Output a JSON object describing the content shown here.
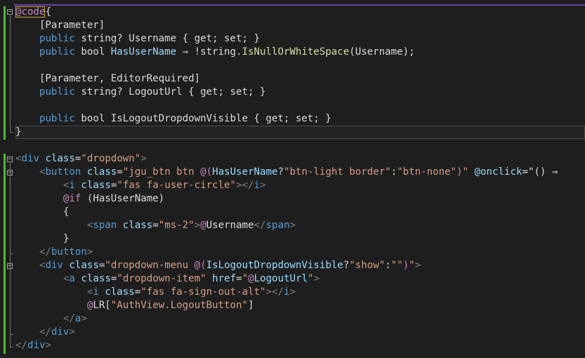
{
  "editor": {
    "language": "razor",
    "lines": [
      [
        [
          "@code",
          "razor"
        ],
        [
          "{",
          "plain"
        ]
      ],
      [
        [
          "    [Parameter]",
          "plain"
        ]
      ],
      [
        [
          "    ",
          "plain"
        ],
        [
          "public",
          "blue"
        ],
        [
          " string? ",
          "plain"
        ],
        [
          "Username",
          "plain"
        ],
        [
          " { get; set; }",
          "plain"
        ]
      ],
      [
        [
          "    ",
          "plain"
        ],
        [
          "public",
          "blue"
        ],
        [
          " bool ",
          "plain"
        ],
        [
          "HasUserName",
          "attr"
        ],
        [
          " ⇒ !string.",
          "plain"
        ],
        [
          "IsNullOrWhiteSpace",
          "method"
        ],
        [
          "(Username);",
          "plain"
        ]
      ],
      [
        [
          "",
          "plain"
        ]
      ],
      [
        [
          "    [Parameter, EditorRequired]",
          "plain"
        ]
      ],
      [
        [
          "    ",
          "plain"
        ],
        [
          "public",
          "blue"
        ],
        [
          " string? LogoutUrl { get; set; }",
          "plain"
        ]
      ],
      [
        [
          "",
          "plain"
        ]
      ],
      [
        [
          "    ",
          "plain"
        ],
        [
          "public",
          "blue"
        ],
        [
          " bool IsLogoutDropdownVisible { get; set; }",
          "plain"
        ]
      ],
      [
        [
          "}",
          "plain"
        ]
      ],
      [
        [
          "",
          "plain"
        ]
      ],
      [
        [
          "<",
          "brk"
        ],
        [
          "div",
          "tag"
        ],
        [
          " ",
          "plain"
        ],
        [
          "class",
          "attr"
        ],
        [
          "=",
          "plain"
        ],
        [
          "\"dropdown\"",
          "str"
        ],
        [
          ">",
          "brk"
        ]
      ],
      [
        [
          "    ",
          "plain"
        ],
        [
          "<",
          "brk"
        ],
        [
          "button",
          "tag"
        ],
        [
          " ",
          "plain"
        ],
        [
          "class",
          "attr"
        ],
        [
          "=",
          "plain"
        ],
        [
          "\"jgu_btn btn ",
          "str"
        ],
        [
          "@(",
          "at"
        ],
        [
          "HasUserName",
          "attr"
        ],
        [
          "?",
          "plain"
        ],
        [
          "\"btn-light border\"",
          "str"
        ],
        [
          ":",
          "plain"
        ],
        [
          "\"btn-none\"",
          "str"
        ],
        [
          ")",
          "at"
        ],
        [
          "\"",
          "str"
        ],
        [
          " ",
          "plain"
        ],
        [
          "@onclick",
          "attr"
        ],
        [
          "=",
          "plain"
        ],
        [
          "\"() ⇒",
          "plain"
        ]
      ],
      [
        [
          "        ",
          "plain"
        ],
        [
          "<",
          "brk"
        ],
        [
          "i",
          "tag"
        ],
        [
          " ",
          "plain"
        ],
        [
          "class",
          "attr"
        ],
        [
          "=",
          "plain"
        ],
        [
          "\"fas fa-user-circle\"",
          "str"
        ],
        [
          "></",
          "brk"
        ],
        [
          "i",
          "tag"
        ],
        [
          ">",
          "brk"
        ]
      ],
      [
        [
          "        ",
          "plain"
        ],
        [
          "@if",
          "razor"
        ],
        [
          " (HasUserName)",
          "plain"
        ]
      ],
      [
        [
          "        {",
          "plain"
        ]
      ],
      [
        [
          "            ",
          "plain"
        ],
        [
          "<",
          "brk"
        ],
        [
          "span",
          "tag"
        ],
        [
          " ",
          "plain"
        ],
        [
          "class",
          "attr"
        ],
        [
          "=",
          "plain"
        ],
        [
          "\"ms-2\"",
          "str"
        ],
        [
          ">",
          "brk"
        ],
        [
          "@",
          "at"
        ],
        [
          "Username",
          "plain"
        ],
        [
          "</",
          "brk"
        ],
        [
          "span",
          "tag"
        ],
        [
          ">",
          "brk"
        ]
      ],
      [
        [
          "        }",
          "plain"
        ]
      ],
      [
        [
          "    ",
          "plain"
        ],
        [
          "</",
          "brk"
        ],
        [
          "button",
          "tag"
        ],
        [
          ">",
          "brk"
        ]
      ],
      [
        [
          "    ",
          "plain"
        ],
        [
          "<",
          "brk"
        ],
        [
          "div",
          "tag"
        ],
        [
          " ",
          "plain"
        ],
        [
          "class",
          "attr"
        ],
        [
          "=",
          "plain"
        ],
        [
          "\"dropdown-menu ",
          "str"
        ],
        [
          "@(",
          "at"
        ],
        [
          "IsLogoutDropdownVisible",
          "attr"
        ],
        [
          "?",
          "plain"
        ],
        [
          "\"show\"",
          "str"
        ],
        [
          ":",
          "plain"
        ],
        [
          "\"\"",
          "str"
        ],
        [
          ")",
          "at"
        ],
        [
          "\"",
          "str"
        ],
        [
          ">",
          "brk"
        ]
      ],
      [
        [
          "        ",
          "plain"
        ],
        [
          "<",
          "brk"
        ],
        [
          "a",
          "tag"
        ],
        [
          " ",
          "plain"
        ],
        [
          "class",
          "attr"
        ],
        [
          "=",
          "plain"
        ],
        [
          "\"dropdown-item\"",
          "str"
        ],
        [
          " ",
          "plain"
        ],
        [
          "href",
          "attr"
        ],
        [
          "=",
          "plain"
        ],
        [
          "\"",
          "str"
        ],
        [
          "@",
          "at"
        ],
        [
          "LogoutUrl",
          "attr"
        ],
        [
          "\"",
          "str"
        ],
        [
          ">",
          "brk"
        ]
      ],
      [
        [
          "            ",
          "plain"
        ],
        [
          "<",
          "brk"
        ],
        [
          "i",
          "tag"
        ],
        [
          " ",
          "plain"
        ],
        [
          "class",
          "attr"
        ],
        [
          "=",
          "plain"
        ],
        [
          "\"fas fa-sign-out-alt\"",
          "str"
        ],
        [
          "></",
          "brk"
        ],
        [
          "i",
          "tag"
        ],
        [
          ">",
          "brk"
        ]
      ],
      [
        [
          "            ",
          "plain"
        ],
        [
          "@",
          "at"
        ],
        [
          "LR[",
          "plain"
        ],
        [
          "\"AuthView.LogoutButton\"",
          "str"
        ],
        [
          "]",
          "plain"
        ]
      ],
      [
        [
          "        ",
          "plain"
        ],
        [
          "</",
          "brk"
        ],
        [
          "a",
          "tag"
        ],
        [
          ">",
          "brk"
        ]
      ],
      [
        [
          "    ",
          "plain"
        ],
        [
          "</",
          "brk"
        ],
        [
          "div",
          "tag"
        ],
        [
          ">",
          "brk"
        ]
      ],
      [
        [
          "</",
          "brk"
        ],
        [
          "div",
          "tag"
        ],
        [
          ">",
          "brk"
        ]
      ]
    ]
  },
  "colors": {
    "background": "#1e1e1e",
    "keyword": "#569cd6",
    "attribute": "#9cdcfe",
    "string": "#d69d85",
    "razor": "#c586c0",
    "bracket": "#808080",
    "method": "#dcdcaa",
    "plain": "#dcdcdc",
    "change_bar": "#4fb93a",
    "top_border": "#6b3fa8"
  },
  "fold_markers": [
    "collapse-icon",
    "collapse-icon",
    "collapse-icon",
    "collapse-icon"
  ]
}
